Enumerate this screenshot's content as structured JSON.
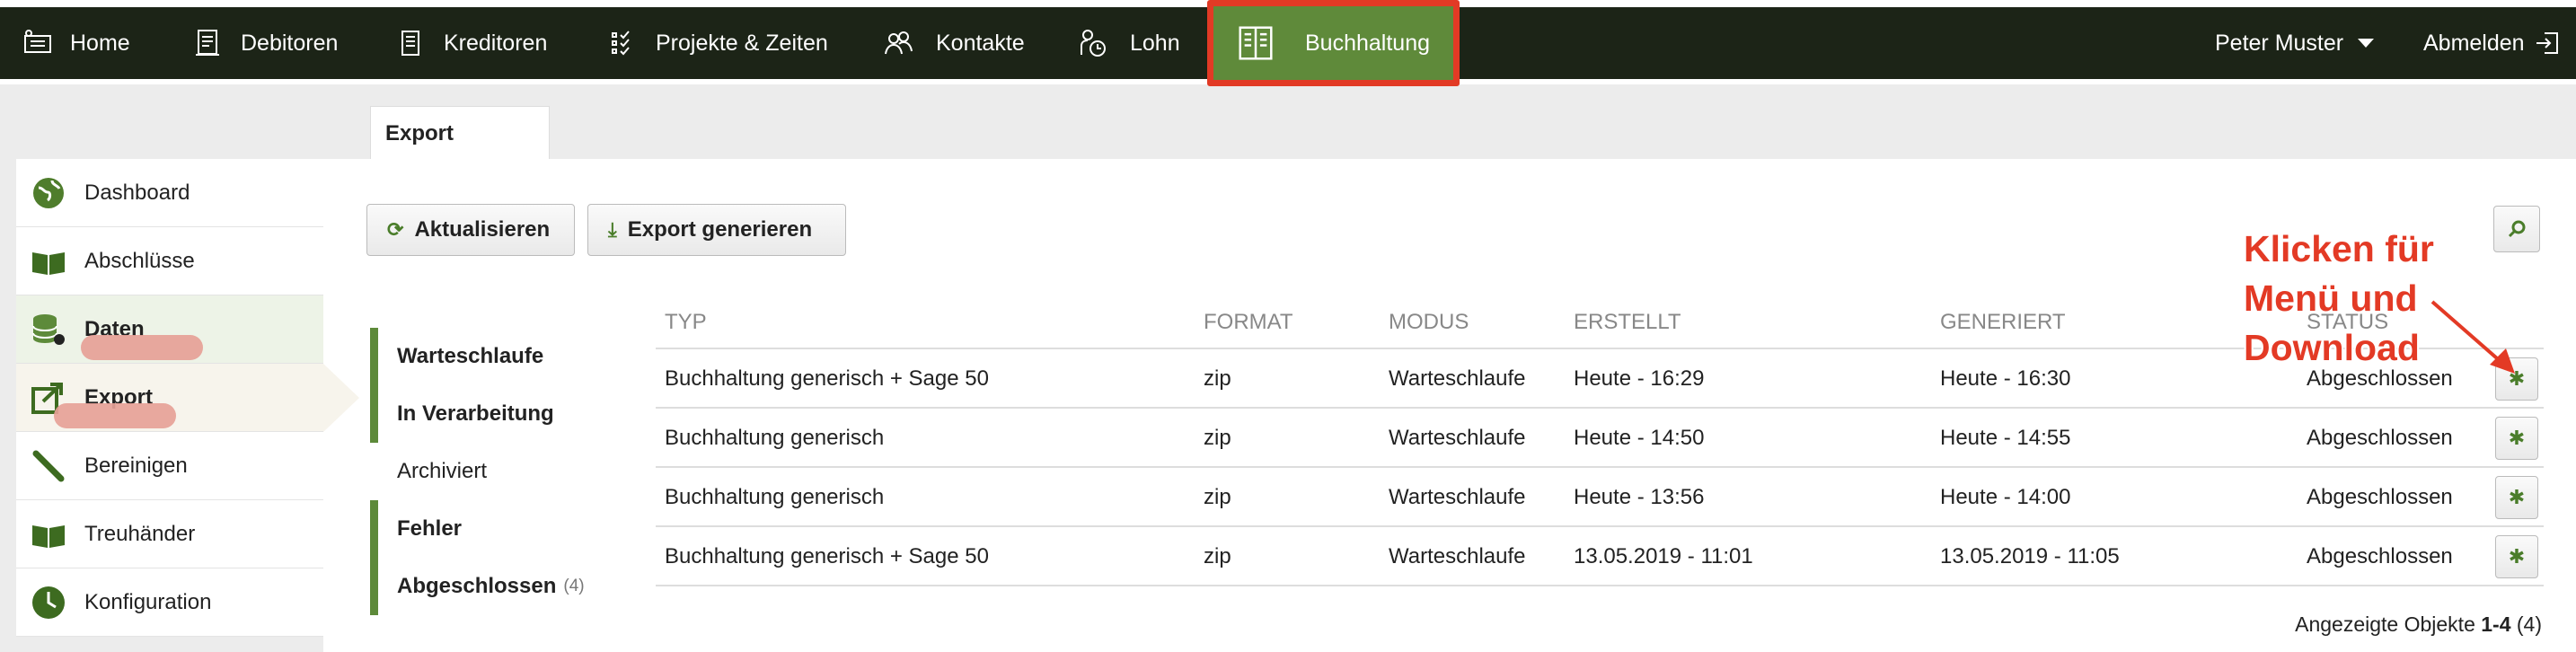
{
  "nav": {
    "items": [
      {
        "label": "Home",
        "icon": "home-icon"
      },
      {
        "label": "Debitoren",
        "icon": "invoice-icon"
      },
      {
        "label": "Kreditoren",
        "icon": "bill-icon"
      },
      {
        "label": "Projekte & Zeiten",
        "icon": "checklist-icon"
      },
      {
        "label": "Kontakte",
        "icon": "people-icon"
      },
      {
        "label": "Lohn",
        "icon": "salary-icon"
      },
      {
        "label": "Buchhaltung",
        "icon": "ledger-icon"
      }
    ],
    "user": "Peter Muster",
    "logout": "Abmelden"
  },
  "tab": "Export",
  "sidebar": [
    {
      "label": "Dashboard",
      "icon": "globe-icon"
    },
    {
      "label": "Abschlüsse",
      "icon": "book-icon"
    },
    {
      "label": "Daten",
      "icon": "database-icon"
    },
    {
      "label": "Export",
      "icon": "export-icon"
    },
    {
      "label": "Bereinigen",
      "icon": "brush-icon"
    },
    {
      "label": "Treuhänder",
      "icon": "book-icon"
    },
    {
      "label": "Konfiguration",
      "icon": "clock-icon"
    }
  ],
  "toolbar": {
    "refresh": "Aktualisieren",
    "generate": "Export generieren"
  },
  "filters": [
    {
      "label": "Warteschlaufe"
    },
    {
      "label": "In Verarbeitung"
    },
    {
      "label": "Archiviert"
    },
    {
      "label": "Fehler"
    },
    {
      "label": "Abgeschlossen",
      "count": "(4)"
    }
  ],
  "table": {
    "headers": [
      "TYP",
      "FORMAT",
      "MODUS",
      "ERSTELLT",
      "GENERIERT",
      "STATUS"
    ],
    "rows": [
      [
        "Buchhaltung generisch + Sage 50",
        "zip",
        "Warteschlaufe",
        "Heute - 16:29",
        "Heute - 16:30",
        "Abgeschlossen"
      ],
      [
        "Buchhaltung generisch",
        "zip",
        "Warteschlaufe",
        "Heute - 14:50",
        "Heute - 14:55",
        "Abgeschlossen"
      ],
      [
        "Buchhaltung generisch",
        "zip",
        "Warteschlaufe",
        "Heute - 13:56",
        "Heute - 14:00",
        "Abgeschlossen"
      ],
      [
        "Buchhaltung generisch + Sage 50",
        "zip",
        "Warteschlaufe",
        "13.05.2019 - 11:01",
        "13.05.2019 - 11:05",
        "Abgeschlossen"
      ]
    ]
  },
  "footer": {
    "prefix": "Angezeigte Objekte ",
    "range": "1-4",
    "total": " (4)"
  },
  "annotation": [
    "Klicken für",
    "Menü und",
    "Download"
  ],
  "colors": {
    "nav_bg": "#1c2417",
    "accent_green": "#5f8a3a",
    "highlight_red": "#e23a25"
  }
}
